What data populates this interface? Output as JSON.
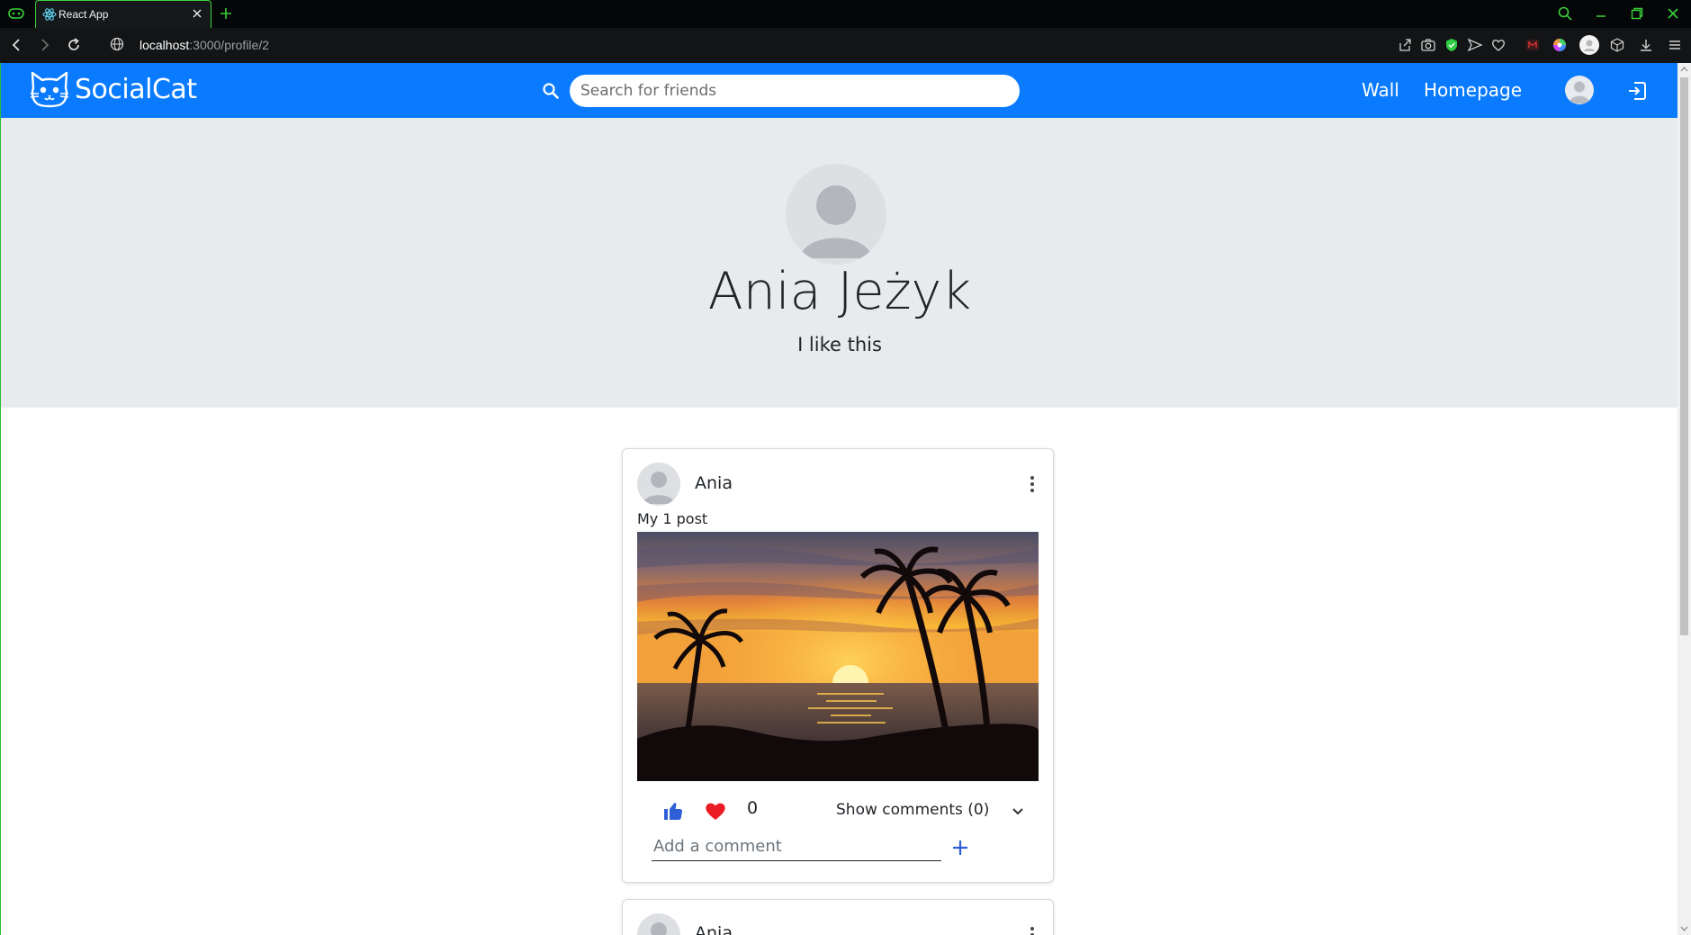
{
  "browser": {
    "tab_title": "React App",
    "url_host": "localhost",
    "url_rest": ":3000/profile/2"
  },
  "navbar": {
    "brand": "SocialCat",
    "search_placeholder": "Search for friends",
    "links": [
      "Wall",
      "Homepage"
    ],
    "accent_color": "#0a7bff"
  },
  "profile": {
    "name": "Ania Jeżyk",
    "bio": "I like this",
    "hero_background": "#e8ebee"
  },
  "posts": [
    {
      "author": "Ania",
      "text": "My 1 post",
      "image": "sunset-beach-palm-trees",
      "likes": "0",
      "show_comments_label": "Show comments (0)",
      "comment_placeholder": "Add a comment"
    },
    {
      "author": "Ania"
    }
  ],
  "icons": {
    "like": "thumbs-up-icon",
    "love": "heart-icon",
    "logout": "logout-icon",
    "menu": "kebab-menu-icon"
  }
}
